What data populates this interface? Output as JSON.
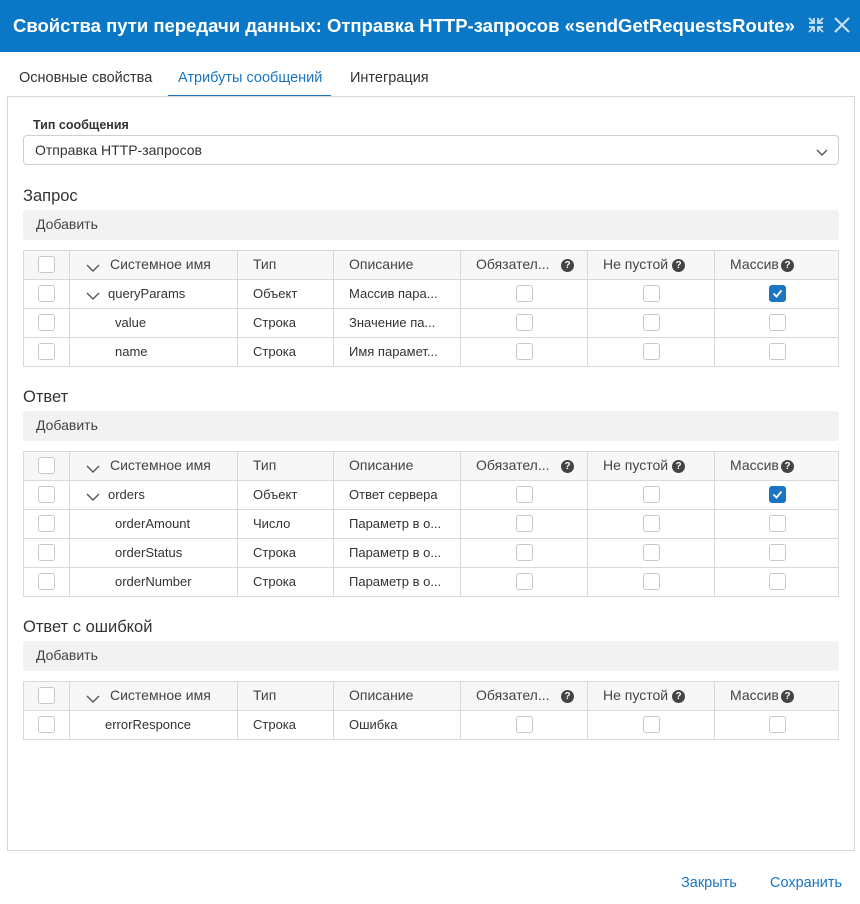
{
  "dialog": {
    "title": "Свойства пути передачи данных: Отправка HTTP-запросов «sendGetRequestsRoute»"
  },
  "tabs": [
    {
      "label": "Основные свойства"
    },
    {
      "label": "Атрибуты сообщений",
      "active": true
    },
    {
      "label": "Интеграция"
    }
  ],
  "message_type": {
    "label": "Тип сообщения",
    "value": "Отправка HTTP-запросов"
  },
  "columns": {
    "name": "Системное имя",
    "type": "Тип",
    "description": "Описание",
    "required": "Обязател...",
    "not_empty": "Не пустой",
    "array": "Массив"
  },
  "add_label": "Добавить",
  "request": {
    "title": "Запрос",
    "rows": [
      {
        "name": "queryParams",
        "type": "Объект",
        "description": "Массив пара...",
        "array": true
      },
      {
        "name": "value",
        "type": "Строка",
        "description": "Значение па...",
        "array": false
      },
      {
        "name": "name",
        "type": "Строка",
        "description": "Имя парамет...",
        "array": false
      }
    ]
  },
  "response": {
    "title": "Ответ",
    "rows": [
      {
        "name": "orders",
        "type": "Объект",
        "description": "Ответ сервера",
        "array": true
      },
      {
        "name": "orderAmount",
        "type": "Число",
        "description": "Параметр в о...",
        "array": false
      },
      {
        "name": "orderStatus",
        "type": "Строка",
        "description": "Параметр в о...",
        "array": false
      },
      {
        "name": "orderNumber",
        "type": "Строка",
        "description": "Параметр в о...",
        "array": false
      }
    ]
  },
  "error_response": {
    "title": "Ответ с ошибкой",
    "rows": [
      {
        "name": "errorResponce",
        "type": "Строка",
        "description": "Ошибка",
        "array": false
      }
    ]
  },
  "footer": {
    "close_label": "Закрыть",
    "save_label": "Сохранить"
  },
  "colors": {
    "accent": "#0b78c7",
    "link": "#1a76c2"
  }
}
